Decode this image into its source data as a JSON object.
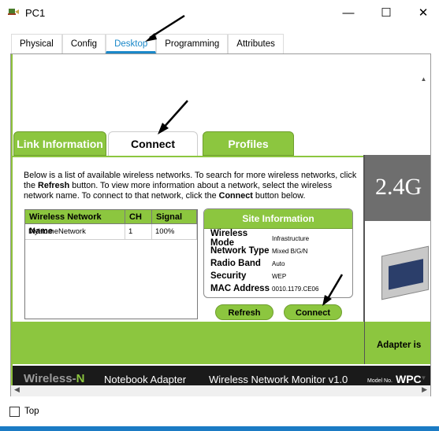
{
  "window": {
    "title": "PC1",
    "minimize_glyph": "—",
    "maximize_glyph": "☐",
    "close_glyph": "✕"
  },
  "tabs": [
    {
      "label": "Physical",
      "active": false
    },
    {
      "label": "Config",
      "active": false
    },
    {
      "label": "Desktop",
      "active": true
    },
    {
      "label": "Programming",
      "active": false
    },
    {
      "label": "Attributes",
      "active": false
    }
  ],
  "subtabs": [
    {
      "label": "Link Information",
      "active": false
    },
    {
      "label": "Connect",
      "active": true
    },
    {
      "label": "Profiles",
      "active": false
    }
  ],
  "instructions": {
    "part1": "Below is a list of available wireless networks. To search for more wireless networks, click the ",
    "refresh": "Refresh",
    "part2": " button. To view more information about a network, select the wireless network name. To connect to that network, click the ",
    "connect": "Connect",
    "part3": " button below."
  },
  "network_table": {
    "headers": [
      "Wireless Network Name",
      "CH",
      "Signal"
    ],
    "rows": [
      [
        "MyHomeNetwork",
        "1",
        "100%"
      ]
    ]
  },
  "site_info": {
    "title": "Site Information",
    "rows": [
      {
        "label": "Wireless Mode",
        "value": "Infrastructure"
      },
      {
        "label": "Network Type",
        "value": "Mixed B/G/N"
      },
      {
        "label": "Radio Band",
        "value": "Auto"
      },
      {
        "label": "Security",
        "value": "WEP"
      },
      {
        "label": "MAC Address",
        "value": "0010.1179.CE06"
      }
    ]
  },
  "buttons": {
    "refresh": "Refresh",
    "connect": "Connect"
  },
  "promo": {
    "band": "2.4",
    "band_suffix": "G",
    "adapter_text": "Adapter is"
  },
  "footer_bar": {
    "wireless": "Wireless-",
    "n": "N",
    "notebook": "Notebook Adapter",
    "monitor": "Wireless Network Monitor  v1.0",
    "model_label": "Model No.",
    "model": "WPC"
  },
  "bottom": {
    "top_label": "Top"
  },
  "colors": {
    "accent_green": "#8cc63f",
    "tab_blue": "#1a88c9"
  },
  "icons": [
    "app-icon",
    "minimize-icon",
    "maximize-icon",
    "close-icon",
    "scroll-up-icon",
    "scroll-down-icon",
    "scroll-left-icon",
    "scroll-right-icon"
  ]
}
